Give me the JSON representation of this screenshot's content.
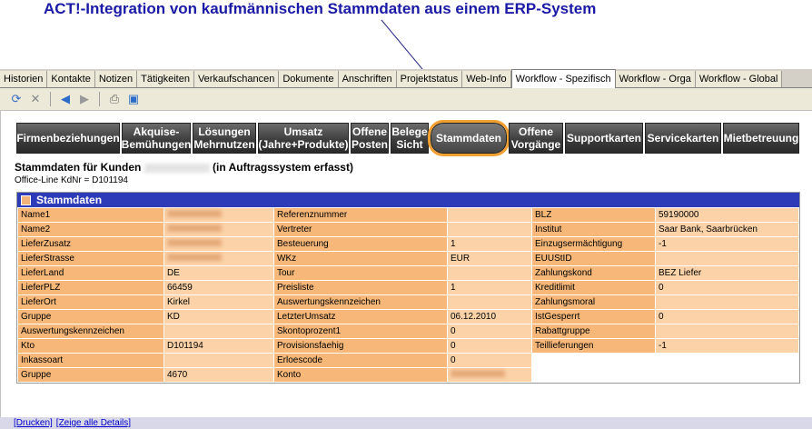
{
  "headline": "ACT!-Integration von kaufmännischen Stammdaten aus einem ERP-System",
  "tabs": [
    {
      "label": "Historien"
    },
    {
      "label": "Kontakte"
    },
    {
      "label": "Notizen"
    },
    {
      "label": "Tätigkeiten"
    },
    {
      "label": "Verkaufschancen"
    },
    {
      "label": "Dokumente"
    },
    {
      "label": "Anschriften"
    },
    {
      "label": "Projektstatus"
    },
    {
      "label": "Web-Info"
    },
    {
      "label": "Workflow - Spezifisch",
      "active": true
    },
    {
      "label": "Workflow - Orga"
    },
    {
      "label": "Workflow - Global"
    }
  ],
  "toolbar_icons": [
    "refresh-icon",
    "delete-icon",
    "back-icon",
    "forward-icon",
    "print-icon",
    "window-icon"
  ],
  "nav_buttons": [
    {
      "label": "Firmenbeziehungen"
    },
    {
      "label": "Akquise-\nBemühungen"
    },
    {
      "label": "Lösungen\nMehrnutzen"
    },
    {
      "label": "Umsatz\n(Jahre+Produkte)"
    },
    {
      "label": "Offene\nPosten"
    },
    {
      "label": "Belege\nSicht"
    },
    {
      "label": "Stammdaten",
      "highlight": true
    },
    {
      "label": "Offene\nVorgänge"
    },
    {
      "label": "Supportkarten"
    },
    {
      "label": "Servicekarten"
    },
    {
      "label": "Mietbetreuung"
    }
  ],
  "title_prefix": "Stammdaten für Kunden",
  "title_suffix": "(in Auftragssystem erfasst)",
  "subtitle": "Office-Line KdNr = D101194",
  "panel_title": "Stammdaten",
  "rows": [
    [
      "Name1",
      "",
      "Referenznummer",
      "",
      "BLZ",
      "59190000"
    ],
    [
      "Name2",
      "",
      "Vertreter",
      "",
      "Institut",
      "Saar Bank, Saarbrücken"
    ],
    [
      "LieferZusatz",
      "",
      "Besteuerung",
      "1",
      "Einzugsermächtigung",
      "-1"
    ],
    [
      "LieferStrasse",
      "",
      "WKz",
      "EUR",
      "EUUStID",
      ""
    ],
    [
      "LieferLand",
      "DE",
      "Tour",
      "",
      "Zahlungskond",
      "BEZ Liefer"
    ],
    [
      "LieferPLZ",
      "66459",
      "Preisliste",
      "1",
      "Kreditlimit",
      "0"
    ],
    [
      "LieferOrt",
      "Kirkel",
      "Auswertungskennzeichen",
      "",
      "Zahlungsmoral",
      ""
    ],
    [
      "Gruppe",
      "KD",
      "LetzterUmsatz",
      "06.12.2010",
      "IstGesperrt",
      "0"
    ],
    [
      "Auswertungskennzeichen",
      "",
      "Skontoprozent1",
      "0",
      "Rabattgruppe",
      ""
    ],
    [
      "Kto",
      "D101194",
      "Provisionsfaehig",
      "0",
      "Teillieferungen",
      "-1"
    ],
    [
      "Inkassoart",
      "",
      "Erloescode",
      "0",
      "",
      ""
    ],
    [
      "Gruppe",
      "4670",
      "Konto",
      "",
      "",
      ""
    ]
  ],
  "footer_links": [
    "[Drucken]",
    "[Zeige alle Details]"
  ],
  "colors": {
    "label_bg": "#f6b778",
    "value_bg": "#fcd3a8",
    "header_bg": "#2e3bb8",
    "highlight": "#f0a030"
  }
}
